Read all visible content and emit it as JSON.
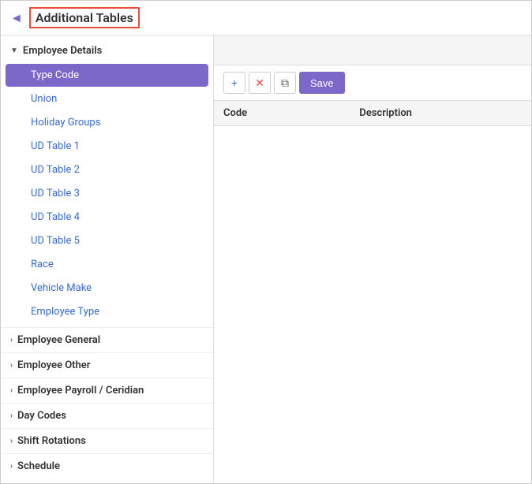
{
  "header": {
    "icon": "◄",
    "title": "Additional Tables"
  },
  "sidebar": {
    "employee_details": {
      "label": "Employee Details",
      "expanded": true,
      "items": [
        {
          "id": "type-code",
          "label": "Type Code",
          "active": true
        },
        {
          "id": "union",
          "label": "Union",
          "active": false
        },
        {
          "id": "holiday-groups",
          "label": "Holiday Groups",
          "active": false
        },
        {
          "id": "ud-table-1",
          "label": "UD Table 1",
          "active": false
        },
        {
          "id": "ud-table-2",
          "label": "UD Table 2",
          "active": false
        },
        {
          "id": "ud-table-3",
          "label": "UD Table 3",
          "active": false
        },
        {
          "id": "ud-table-4",
          "label": "UD Table 4",
          "active": false
        },
        {
          "id": "ud-table-5",
          "label": "UD Table 5",
          "active": false
        },
        {
          "id": "race",
          "label": "Race",
          "active": false
        },
        {
          "id": "vehicle-make",
          "label": "Vehicle Make",
          "active": false
        },
        {
          "id": "employee-type",
          "label": "Employee Type",
          "active": false
        }
      ]
    },
    "collapsed_groups": [
      {
        "id": "employee-general",
        "label": "Employee General"
      },
      {
        "id": "employee-other",
        "label": "Employee Other"
      },
      {
        "id": "employee-payroll",
        "label": "Employee Payroll / Ceridian"
      },
      {
        "id": "day-codes",
        "label": "Day Codes"
      },
      {
        "id": "shift-rotations",
        "label": "Shift Rotations"
      },
      {
        "id": "schedule",
        "label": "Schedule"
      }
    ]
  },
  "toolbar": {
    "add_icon": "+",
    "remove_icon": "✕",
    "copy_icon": "⧉",
    "save_label": "Save"
  },
  "table": {
    "columns": [
      {
        "id": "code",
        "label": "Code"
      },
      {
        "id": "description",
        "label": "Description"
      }
    ],
    "rows": []
  }
}
